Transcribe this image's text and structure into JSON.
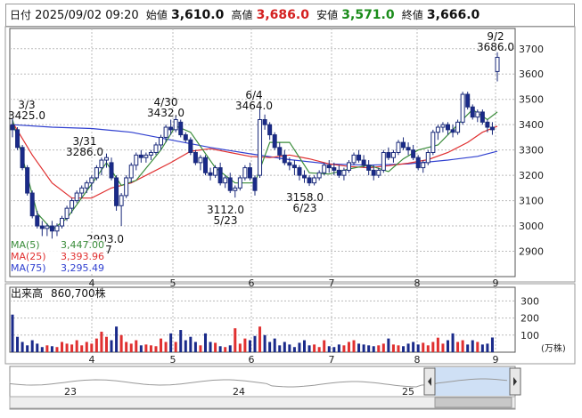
{
  "header": {
    "date_label": "日付",
    "datetime": "2025/09/02 09:20",
    "open_label": "始値",
    "open": "3,610.0",
    "high_label": "高値",
    "high": "3,686.0",
    "low_label": "安値",
    "low": "3,571.0",
    "close_label": "終値",
    "close": "3,666.0",
    "colors": {
      "open": "#111111",
      "high": "#d42020",
      "low": "#1a8c1a",
      "close": "#111111"
    }
  },
  "chart_data": {
    "type": "candlestick",
    "price_axis": {
      "ticks": [
        2900,
        3000,
        3100,
        3200,
        3300,
        3400,
        3500,
        3600,
        3700
      ],
      "min": 2800,
      "max": 3780
    },
    "month_labels": [
      "4",
      "5",
      "6",
      "7",
      "8",
      "9"
    ],
    "annotations": [
      {
        "date": "3/3",
        "value": "3425.0",
        "anchor": "high"
      },
      {
        "date": "3/31",
        "value": "3286.0",
        "anchor": "high"
      },
      {
        "date": "4/30",
        "value": "3432.0",
        "anchor": "high"
      },
      {
        "date": "6/4",
        "value": "3464.0",
        "anchor": "high"
      },
      {
        "date": "5/23",
        "value": "3112.0",
        "anchor": "low"
      },
      {
        "date": "6/23",
        "value": "3158.0",
        "anchor": "low"
      },
      {
        "date": "9/2",
        "value": "3686.0",
        "anchor": "high"
      }
    ],
    "low_annotation": {
      "value": "2903.0",
      "date_fragment": "7"
    },
    "ma_legend": [
      {
        "name": "MA(5)",
        "value": "3,447.00",
        "color": "#3a8c3a"
      },
      {
        "name": "MA(25)",
        "value": "3,393.96",
        "color": "#e03030"
      },
      {
        "name": "MA(75)",
        "value": "3,295.49",
        "color": "#3040d0"
      }
    ],
    "candles": [
      [
        3400,
        3425,
        3350,
        3380
      ],
      [
        3380,
        3390,
        3300,
        3310
      ],
      [
        3310,
        3320,
        3220,
        3230
      ],
      [
        3230,
        3240,
        3120,
        3130
      ],
      [
        3130,
        3140,
        3030,
        3040
      ],
      [
        3040,
        3060,
        2990,
        3000
      ],
      [
        3000,
        3020,
        2960,
        2990
      ],
      [
        2990,
        3010,
        2960,
        3000
      ],
      [
        3000,
        3020,
        2950,
        2980
      ],
      [
        2980,
        3010,
        2960,
        3000
      ],
      [
        3000,
        3040,
        2990,
        3030
      ],
      [
        3030,
        3080,
        3020,
        3070
      ],
      [
        3070,
        3110,
        3050,
        3100
      ],
      [
        3100,
        3140,
        3090,
        3130
      ],
      [
        3130,
        3160,
        3110,
        3150
      ],
      [
        3150,
        3180,
        3130,
        3170
      ],
      [
        3170,
        3200,
        3140,
        3190
      ],
      [
        3190,
        3240,
        3180,
        3230
      ],
      [
        3230,
        3270,
        3200,
        3260
      ],
      [
        3260,
        3286,
        3230,
        3270
      ],
      [
        3250,
        3270,
        3180,
        3190
      ],
      [
        3190,
        3200,
        3060,
        3080
      ],
      [
        3080,
        3130,
        3000,
        3120
      ],
      [
        3120,
        3200,
        3110,
        3190
      ],
      [
        3190,
        3250,
        3170,
        3240
      ],
      [
        3240,
        3290,
        3220,
        3280
      ],
      [
        3280,
        3300,
        3250,
        3270
      ],
      [
        3270,
        3290,
        3250,
        3280
      ],
      [
        3280,
        3300,
        3260,
        3290
      ],
      [
        3290,
        3330,
        3280,
        3320
      ],
      [
        3320,
        3360,
        3300,
        3350
      ],
      [
        3350,
        3400,
        3330,
        3390
      ],
      [
        3390,
        3420,
        3360,
        3380
      ],
      [
        3380,
        3432,
        3370,
        3420
      ],
      [
        3410,
        3420,
        3350,
        3360
      ],
      [
        3360,
        3370,
        3330,
        3340
      ],
      [
        3340,
        3350,
        3280,
        3290
      ],
      [
        3290,
        3300,
        3240,
        3250
      ],
      [
        3250,
        3280,
        3220,
        3270
      ],
      [
        3270,
        3280,
        3200,
        3210
      ],
      [
        3210,
        3230,
        3180,
        3200
      ],
      [
        3200,
        3240,
        3190,
        3230
      ],
      [
        3230,
        3250,
        3160,
        3170
      ],
      [
        3170,
        3200,
        3150,
        3190
      ],
      [
        3190,
        3210,
        3130,
        3140
      ],
      [
        3140,
        3160,
        3112,
        3150
      ],
      [
        3150,
        3200,
        3140,
        3190
      ],
      [
        3190,
        3240,
        3180,
        3230
      ],
      [
        3230,
        3250,
        3180,
        3190
      ],
      [
        3190,
        3200,
        3120,
        3140
      ],
      [
        3200,
        3464,
        3190,
        3420
      ],
      [
        3420,
        3440,
        3380,
        3400
      ],
      [
        3400,
        3410,
        3340,
        3360
      ],
      [
        3360,
        3370,
        3300,
        3310
      ],
      [
        3310,
        3330,
        3260,
        3280
      ],
      [
        3280,
        3300,
        3240,
        3250
      ],
      [
        3250,
        3270,
        3220,
        3240
      ],
      [
        3240,
        3260,
        3200,
        3230
      ],
      [
        3230,
        3240,
        3180,
        3200
      ],
      [
        3200,
        3220,
        3170,
        3190
      ],
      [
        3190,
        3200,
        3158,
        3170
      ],
      [
        3170,
        3200,
        3160,
        3190
      ],
      [
        3190,
        3220,
        3180,
        3210
      ],
      [
        3210,
        3250,
        3200,
        3240
      ],
      [
        3240,
        3260,
        3210,
        3230
      ],
      [
        3230,
        3250,
        3200,
        3220
      ],
      [
        3220,
        3240,
        3190,
        3200
      ],
      [
        3200,
        3230,
        3180,
        3220
      ],
      [
        3220,
        3260,
        3210,
        3250
      ],
      [
        3250,
        3290,
        3240,
        3280
      ],
      [
        3280,
        3300,
        3250,
        3260
      ],
      [
        3260,
        3280,
        3230,
        3240
      ],
      [
        3240,
        3260,
        3200,
        3220
      ],
      [
        3220,
        3240,
        3180,
        3200
      ],
      [
        3200,
        3230,
        3190,
        3220
      ],
      [
        3220,
        3300,
        3210,
        3290
      ],
      [
        3290,
        3310,
        3260,
        3270
      ],
      [
        3270,
        3300,
        3250,
        3290
      ],
      [
        3290,
        3340,
        3280,
        3330
      ],
      [
        3330,
        3350,
        3300,
        3310
      ],
      [
        3310,
        3330,
        3280,
        3300
      ],
      [
        3300,
        3320,
        3260,
        3270
      ],
      [
        3270,
        3280,
        3220,
        3230
      ],
      [
        3230,
        3260,
        3210,
        3250
      ],
      [
        3250,
        3300,
        3240,
        3290
      ],
      [
        3290,
        3380,
        3280,
        3370
      ],
      [
        3370,
        3400,
        3340,
        3390
      ],
      [
        3390,
        3410,
        3370,
        3400
      ],
      [
        3400,
        3410,
        3360,
        3380
      ],
      [
        3380,
        3400,
        3350,
        3370
      ],
      [
        3370,
        3420,
        3360,
        3410
      ],
      [
        3410,
        3530,
        3400,
        3520
      ],
      [
        3520,
        3530,
        3460,
        3470
      ],
      [
        3470,
        3480,
        3420,
        3430
      ],
      [
        3430,
        3460,
        3410,
        3450
      ],
      [
        3450,
        3460,
        3400,
        3410
      ],
      [
        3410,
        3420,
        3370,
        3390
      ],
      [
        3390,
        3410,
        3360,
        3380
      ],
      [
        3610,
        3686,
        3571,
        3666
      ]
    ],
    "ma5": [
      [
        0,
        3420
      ],
      [
        5,
        3050
      ],
      [
        8,
        2985
      ],
      [
        11,
        3030
      ],
      [
        16,
        3165
      ],
      [
        19,
        3250
      ],
      [
        22,
        3160
      ],
      [
        25,
        3180
      ],
      [
        30,
        3300
      ],
      [
        33,
        3395
      ],
      [
        36,
        3370
      ],
      [
        41,
        3230
      ],
      [
        45,
        3170
      ],
      [
        49,
        3170
      ],
      [
        52,
        3330
      ],
      [
        56,
        3330
      ],
      [
        60,
        3210
      ],
      [
        64,
        3205
      ],
      [
        68,
        3225
      ],
      [
        72,
        3240
      ],
      [
        76,
        3215
      ],
      [
        79,
        3265
      ],
      [
        82,
        3300
      ],
      [
        86,
        3320
      ],
      [
        89,
        3380
      ],
      [
        93,
        3460
      ],
      [
        96,
        3420
      ],
      [
        98,
        3450
      ]
    ],
    "ma25": [
      [
        0,
        3410
      ],
      [
        4,
        3280
      ],
      [
        8,
        3170
      ],
      [
        12,
        3110
      ],
      [
        16,
        3110
      ],
      [
        20,
        3150
      ],
      [
        24,
        3170
      ],
      [
        28,
        3210
      ],
      [
        32,
        3250
      ],
      [
        36,
        3295
      ],
      [
        40,
        3305
      ],
      [
        44,
        3290
      ],
      [
        48,
        3275
      ],
      [
        52,
        3270
      ],
      [
        56,
        3280
      ],
      [
        60,
        3265
      ],
      [
        64,
        3245
      ],
      [
        68,
        3235
      ],
      [
        72,
        3230
      ],
      [
        76,
        3238
      ],
      [
        80,
        3248
      ],
      [
        84,
        3262
      ],
      [
        88,
        3290
      ],
      [
        92,
        3330
      ],
      [
        95,
        3370
      ],
      [
        98,
        3394
      ]
    ],
    "ma75": [
      [
        0,
        3400
      ],
      [
        8,
        3390
      ],
      [
        16,
        3385
      ],
      [
        24,
        3370
      ],
      [
        32,
        3340
      ],
      [
        40,
        3310
      ],
      [
        48,
        3285
      ],
      [
        56,
        3262
      ],
      [
        64,
        3245
      ],
      [
        72,
        3240
      ],
      [
        80,
        3245
      ],
      [
        88,
        3260
      ],
      [
        94,
        3275
      ],
      [
        98,
        3295
      ]
    ],
    "volume_panel": {
      "label": "出来高",
      "value": "860,700株",
      "ticks": [
        100,
        200,
        300
      ],
      "max": 380,
      "unit": "(万株)",
      "volumes": [
        220,
        90,
        60,
        40,
        70,
        50,
        30,
        40,
        35,
        30,
        60,
        50,
        45,
        70,
        40,
        60,
        50,
        80,
        120,
        90,
        70,
        150,
        100,
        60,
        50,
        70,
        40,
        45,
        40,
        35,
        80,
        60,
        110,
        60,
        130,
        70,
        90,
        60,
        40,
        110,
        60,
        55,
        35,
        30,
        40,
        140,
        50,
        80,
        70,
        95,
        150,
        100,
        60,
        80,
        40,
        60,
        45,
        30,
        55,
        70,
        40,
        45,
        30,
        70,
        35,
        30,
        45,
        40,
        60,
        70,
        50,
        45,
        40,
        35,
        40,
        50,
        80,
        45,
        40,
        35,
        50,
        60,
        45,
        55,
        40,
        60,
        85,
        50,
        70,
        110,
        60,
        70,
        45,
        70,
        60,
        45,
        50,
        86
      ]
    },
    "navigator": {
      "labels": [
        "23",
        "24",
        "25"
      ]
    }
  }
}
